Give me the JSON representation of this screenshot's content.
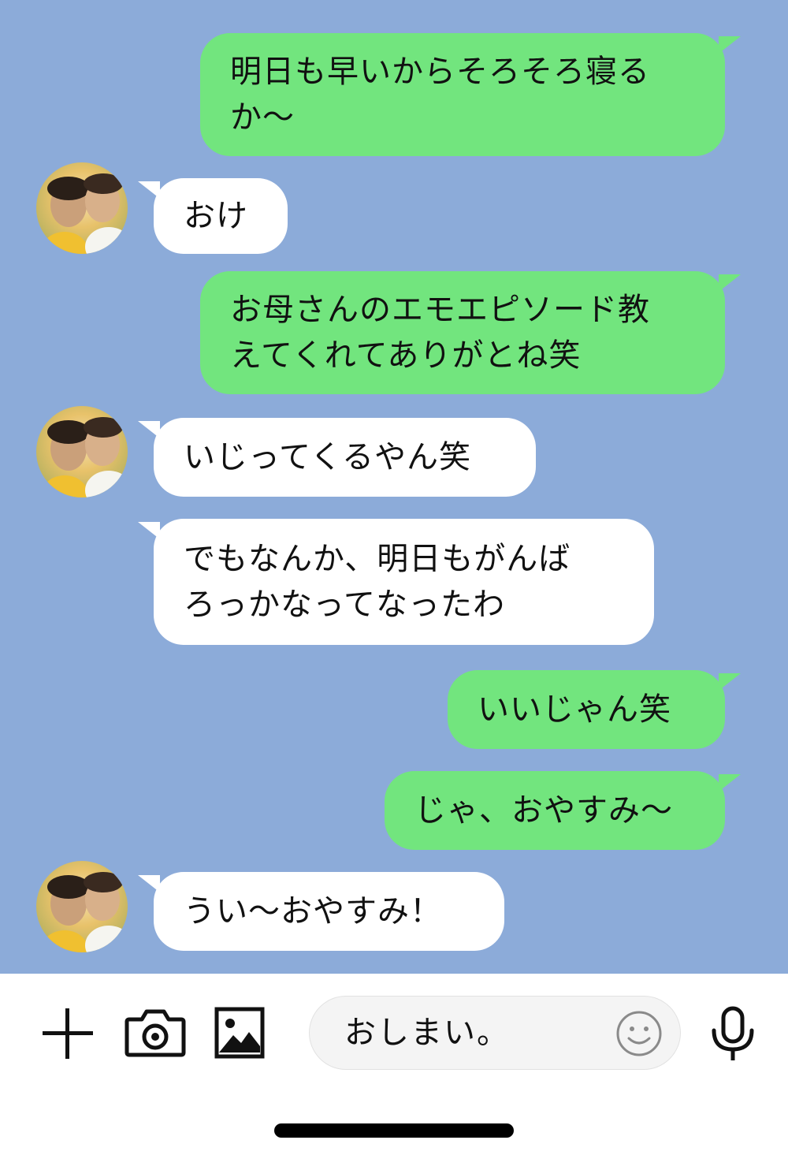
{
  "colors": {
    "chat_bg": "#8cabd9",
    "my_bubble": "#72e57e",
    "their_bubble": "#ffffff"
  },
  "messages": [
    {
      "from": "me",
      "lines": [
        "明日も早いからそろそろ寝る",
        "か〜"
      ]
    },
    {
      "from": "them",
      "lines": [
        "おけ"
      ]
    },
    {
      "from": "me",
      "lines": [
        "お母さんのエモエピソード教",
        "えてくれてありがとね笑"
      ]
    },
    {
      "from": "them",
      "lines": [
        "いじってくるやん笑"
      ]
    },
    {
      "from": "them",
      "lines": [
        "でもなんか、明日もがんば",
        "ろっかなってなったわ"
      ]
    },
    {
      "from": "me",
      "lines": [
        "いいじゃん笑"
      ]
    },
    {
      "from": "me",
      "lines": [
        "じゃ、おやすみ〜"
      ]
    },
    {
      "from": "them",
      "lines": [
        "うい〜おやすみ！"
      ]
    }
  ],
  "composer": {
    "text": "おしまい。",
    "icons": [
      "plus-icon",
      "camera-icon",
      "image-icon",
      "emoji-icon",
      "microphone-icon"
    ]
  }
}
